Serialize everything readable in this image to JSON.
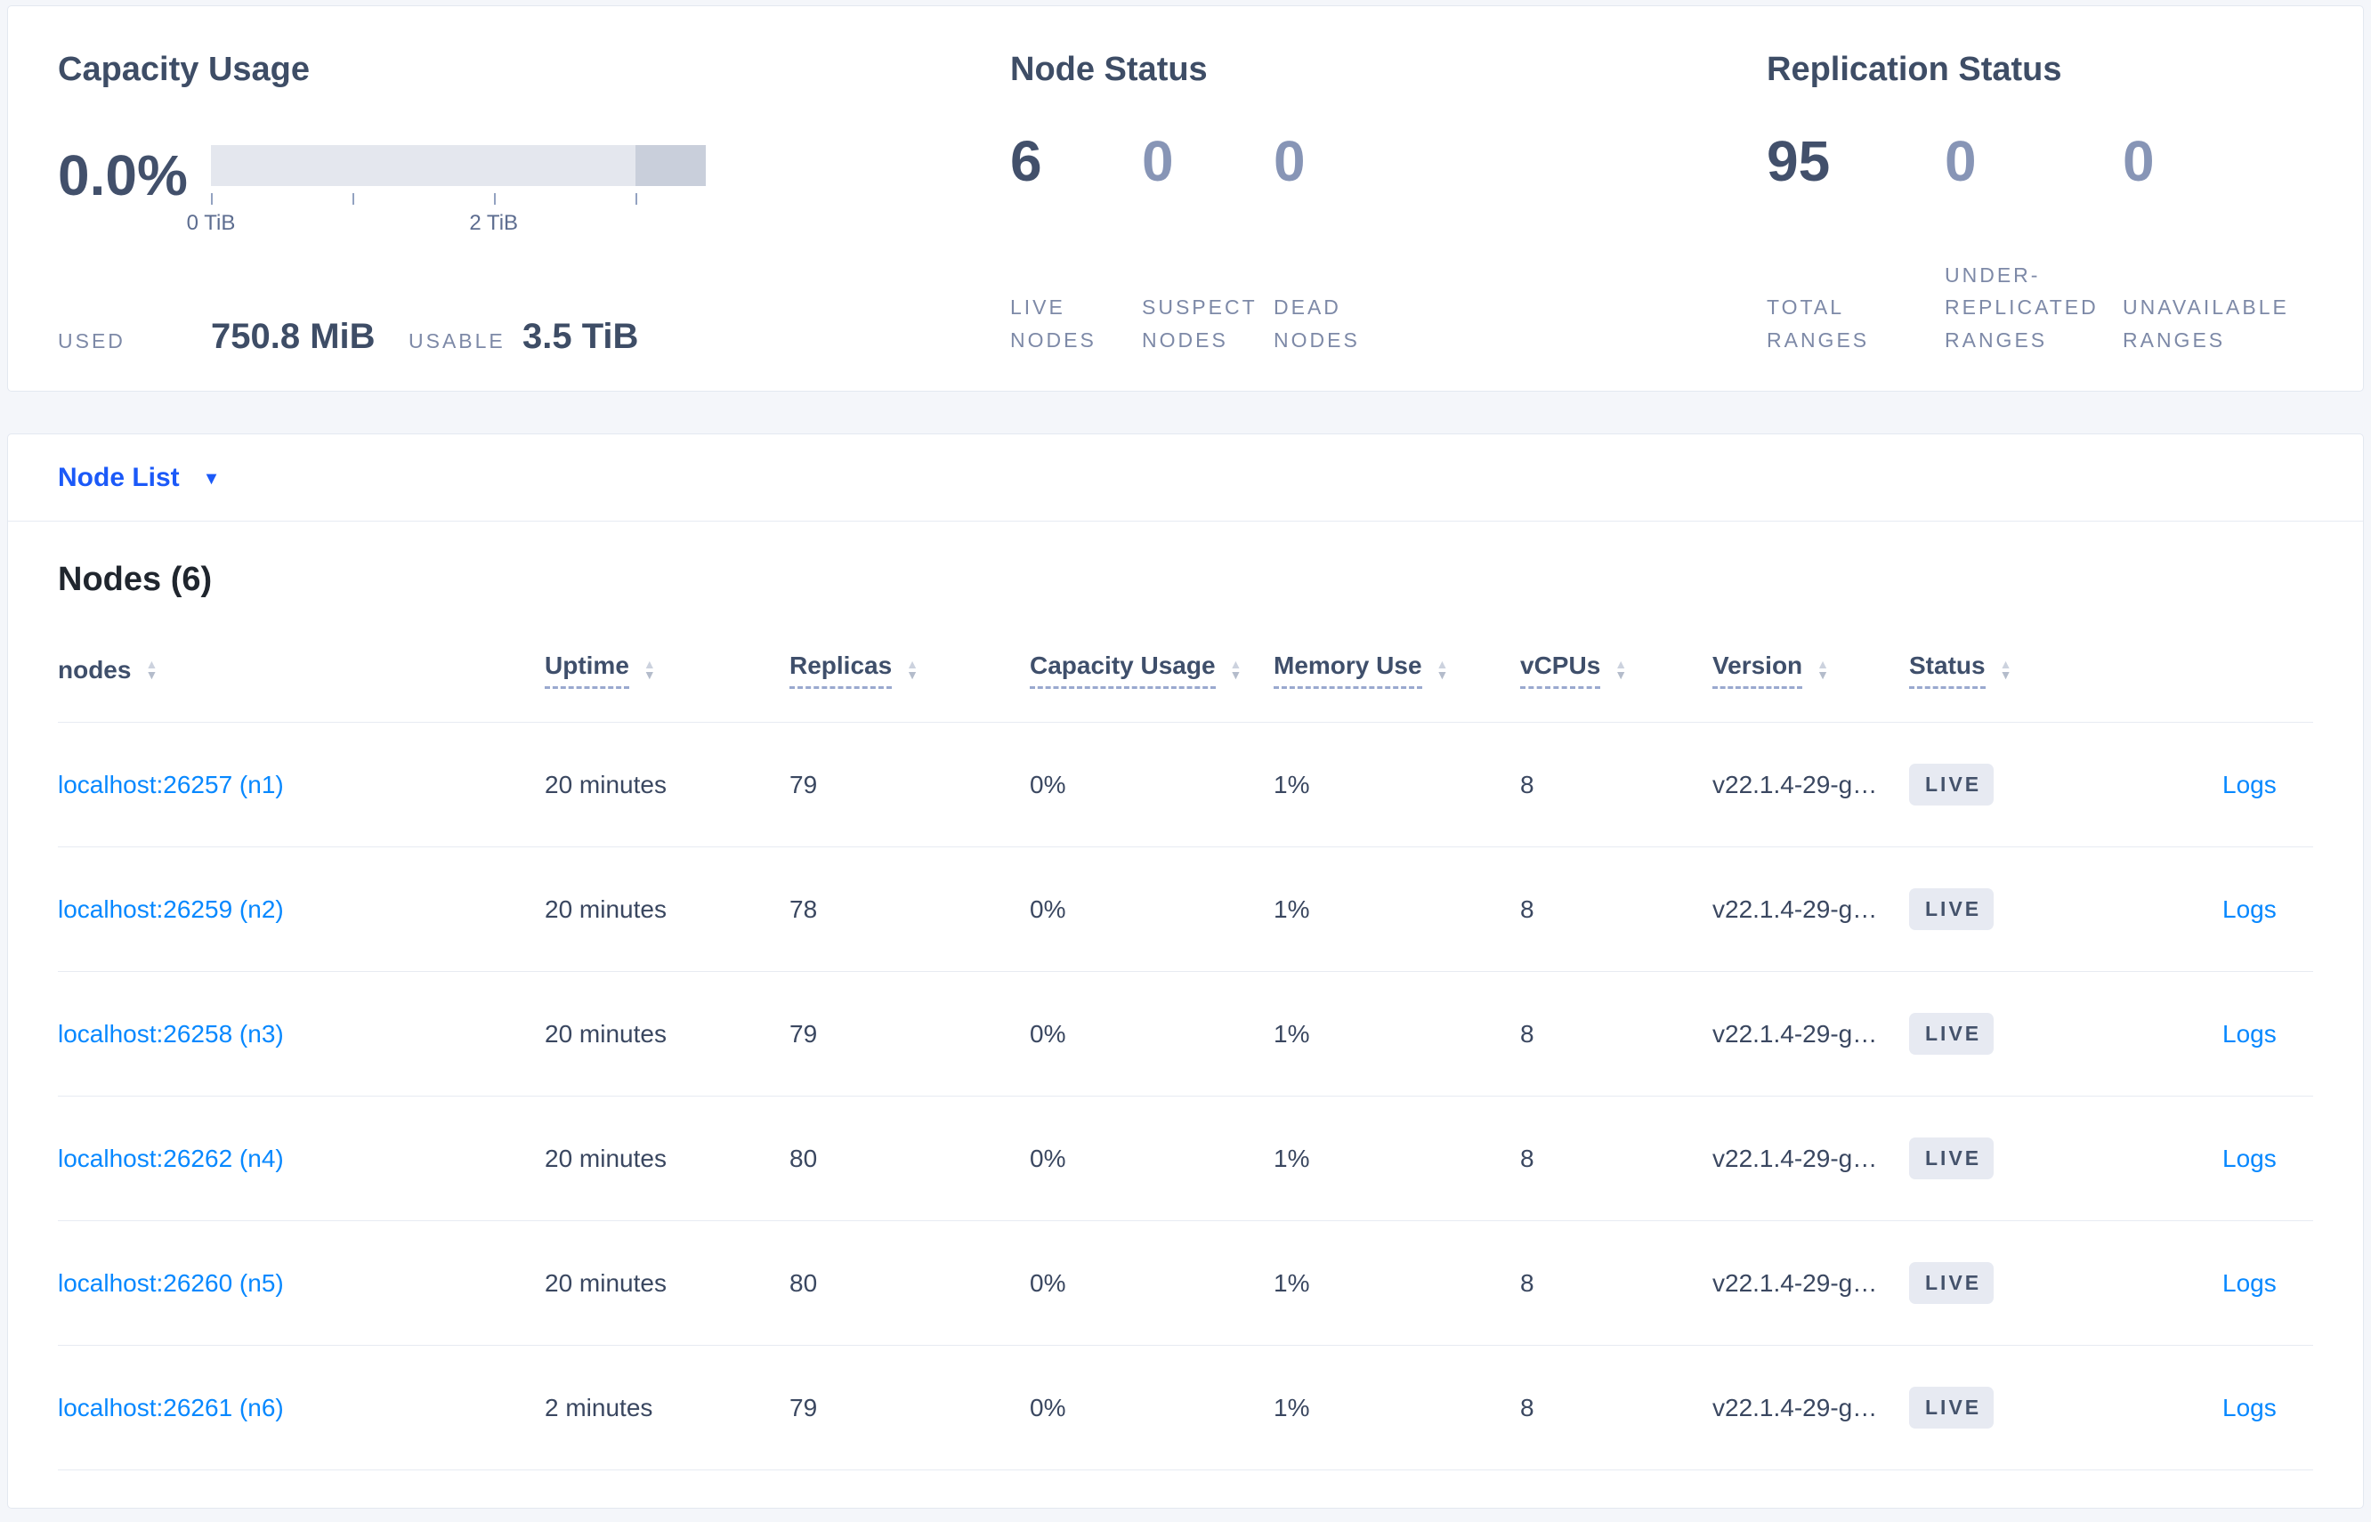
{
  "summary": {
    "capacity": {
      "title": "Capacity Usage",
      "percent": "0.0%",
      "tick_labels": [
        "0 TiB",
        "2 TiB"
      ],
      "used_label": "USED",
      "used_value": "750.8 MiB",
      "usable_label": "USABLE",
      "usable_value": "3.5 TiB"
    },
    "node_status": {
      "title": "Node Status",
      "stats": [
        {
          "value": "6",
          "label": "LIVE\nNODES"
        },
        {
          "value": "0",
          "label": "SUSPECT\nNODES"
        },
        {
          "value": "0",
          "label": "DEAD\nNODES"
        }
      ]
    },
    "replication": {
      "title": "Replication Status",
      "stats": [
        {
          "value": "95",
          "label": "TOTAL\nRANGES"
        },
        {
          "value": "0",
          "label": "UNDER-\nREPLICATED\nRANGES"
        },
        {
          "value": "0",
          "label": "UNAVAILABLE\nRANGES"
        }
      ]
    }
  },
  "node_list": {
    "dropdown_label": "Node List",
    "section_title": "Nodes (6)",
    "columns": [
      {
        "label": "nodes"
      },
      {
        "label": "Uptime"
      },
      {
        "label": "Replicas"
      },
      {
        "label": "Capacity Usage"
      },
      {
        "label": "Memory Use"
      },
      {
        "label": "vCPUs"
      },
      {
        "label": "Version"
      },
      {
        "label": "Status"
      }
    ],
    "rows": [
      {
        "address": "localhost:26257 (n1)",
        "uptime": "20 minutes",
        "replicas": "79",
        "capacity": "0%",
        "memory": "1%",
        "vcpus": "8",
        "version": "v22.1.4-29-g…",
        "status": "LIVE",
        "logs": "Logs"
      },
      {
        "address": "localhost:26259 (n2)",
        "uptime": "20 minutes",
        "replicas": "78",
        "capacity": "0%",
        "memory": "1%",
        "vcpus": "8",
        "version": "v22.1.4-29-g…",
        "status": "LIVE",
        "logs": "Logs"
      },
      {
        "address": "localhost:26258 (n3)",
        "uptime": "20 minutes",
        "replicas": "79",
        "capacity": "0%",
        "memory": "1%",
        "vcpus": "8",
        "version": "v22.1.4-29-g…",
        "status": "LIVE",
        "logs": "Logs"
      },
      {
        "address": "localhost:26262 (n4)",
        "uptime": "20 minutes",
        "replicas": "80",
        "capacity": "0%",
        "memory": "1%",
        "vcpus": "8",
        "version": "v22.1.4-29-g…",
        "status": "LIVE",
        "logs": "Logs"
      },
      {
        "address": "localhost:26260 (n5)",
        "uptime": "20 minutes",
        "replicas": "80",
        "capacity": "0%",
        "memory": "1%",
        "vcpus": "8",
        "version": "v22.1.4-29-g…",
        "status": "LIVE",
        "logs": "Logs"
      },
      {
        "address": "localhost:26261 (n6)",
        "uptime": "2 minutes",
        "replicas": "79",
        "capacity": "0%",
        "memory": "1%",
        "vcpus": "8",
        "version": "v22.1.4-29-g…",
        "status": "LIVE",
        "logs": "Logs"
      }
    ]
  },
  "icons": {
    "sort_asc": "▲",
    "sort_desc": "▼",
    "dropdown_caret": "▼"
  },
  "colors": {
    "page_background": "#f4f6fa",
    "card_border": "#e3e8f0",
    "primary_blue": "#1b59f8",
    "link_blue": "#0788ff",
    "dark_text": "#3e4d66",
    "muted_stat_number": "#8795b6",
    "stat_label_gray": "#7d89a7",
    "badge_background": "#e7eaf2",
    "bar_track": "#e4e7ee",
    "bar_dark_segment": "#c9cfdb"
  }
}
